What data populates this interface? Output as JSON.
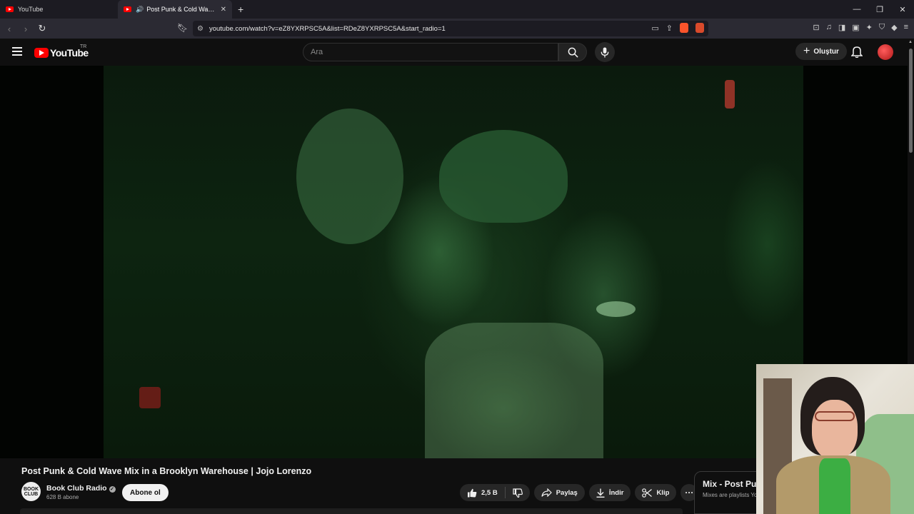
{
  "browser": {
    "tabs": [
      {
        "title": "YouTube",
        "active": false
      },
      {
        "title": "Post Punk & Cold Wave Mix i",
        "active": true,
        "audio": true
      }
    ],
    "url": "youtube.com/watch?v=eZ8YXRPSC5A&list=RDeZ8YXRPSC5A&start_radio=1"
  },
  "youtube": {
    "logo_text": "YouTube",
    "region": "TR",
    "search_placeholder": "Ara",
    "create_label": "Oluştur"
  },
  "video": {
    "title": "Post Punk & Cold Wave Mix in a Brooklyn Warehouse | Jojo Lorenzo",
    "channel_name": "Book Club Radio",
    "channel_avatar_text": "BOOK CLUB",
    "subscribers": "628 B abone",
    "subscribe_label": "Abone ol",
    "likes": "2,5 B",
    "share_label": "Paylaş",
    "download_label": "İndir",
    "clip_label": "Klip"
  },
  "mix_panel": {
    "title": "Mix - Post Pu",
    "subtitle": "Mixes are playlists Yo"
  },
  "colors": {
    "background": "#0f0f0f",
    "youtube_red": "#ff0000",
    "pill_bg": "#272727"
  }
}
